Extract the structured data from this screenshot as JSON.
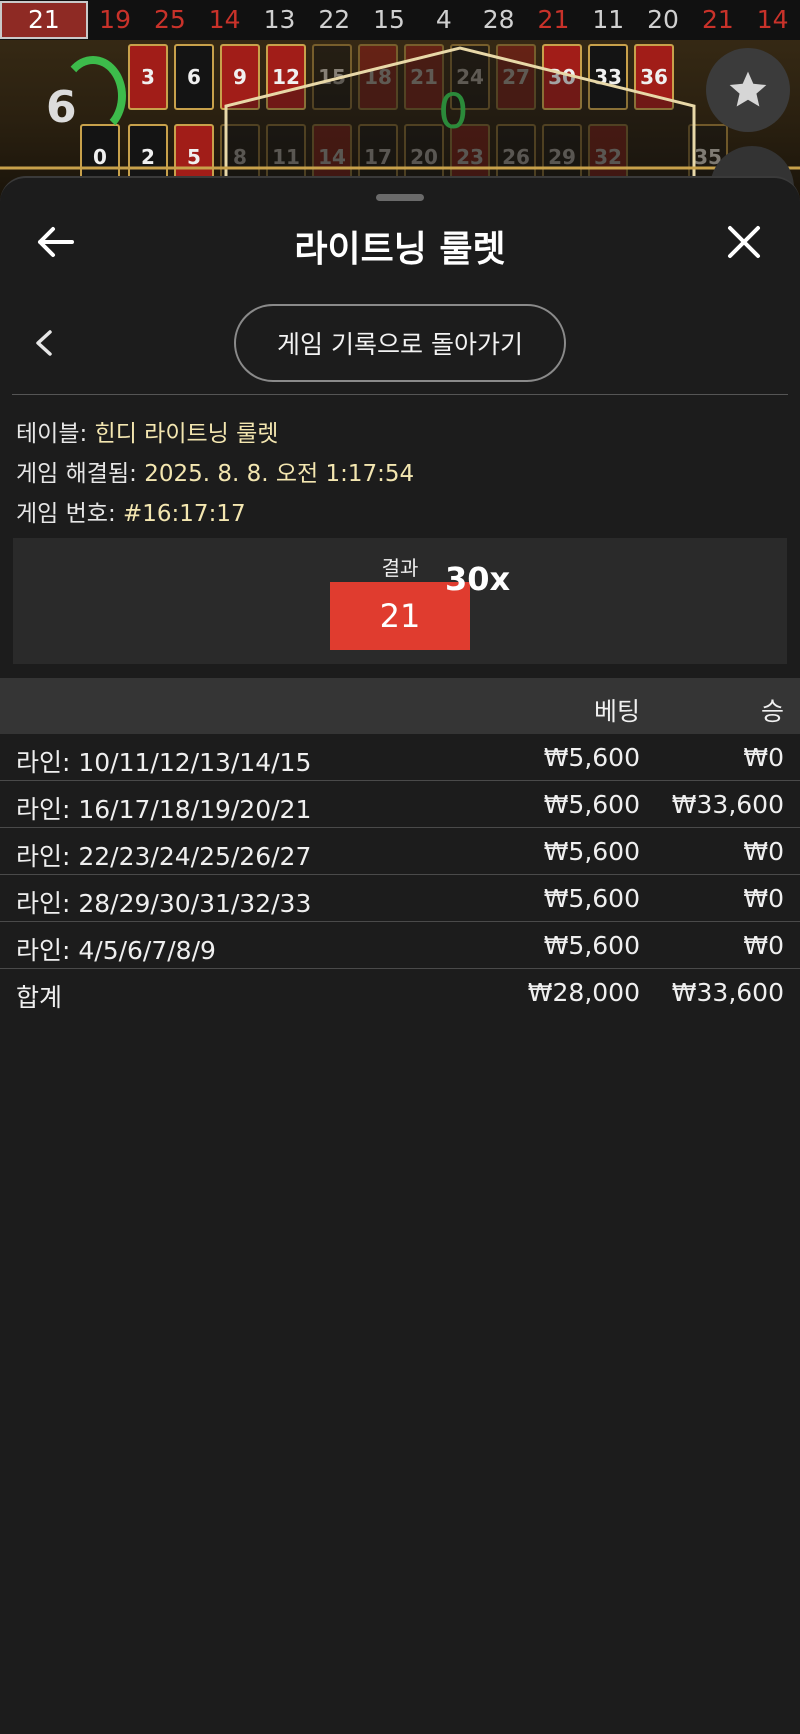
{
  "history": {
    "numbers": [
      {
        "n": "21",
        "color": "red",
        "current": true
      },
      {
        "n": "19",
        "color": "red"
      },
      {
        "n": "25",
        "color": "red"
      },
      {
        "n": "14",
        "color": "red"
      },
      {
        "n": "13",
        "color": "black"
      },
      {
        "n": "22",
        "color": "black"
      },
      {
        "n": "15",
        "color": "black"
      },
      {
        "n": "4",
        "color": "black"
      },
      {
        "n": "28",
        "color": "black"
      },
      {
        "n": "21",
        "color": "red"
      },
      {
        "n": "11",
        "color": "black"
      },
      {
        "n": "20",
        "color": "black"
      },
      {
        "n": "21",
        "color": "red"
      },
      {
        "n": "14",
        "color": "red"
      }
    ]
  },
  "game": {
    "timer": "6",
    "zero": "0",
    "board_top": [
      "3",
      "6",
      "9",
      "12",
      "15",
      "18",
      "21",
      "24",
      "27",
      "30",
      "33",
      "36"
    ],
    "board_mid": [
      "0",
      "2",
      "5",
      "8",
      "11",
      "14",
      "17",
      "20",
      "23",
      "26",
      "29",
      "32",
      "35"
    ]
  },
  "sheet": {
    "title": "라이트닝 룰렛",
    "history_button": "게임 기록으로 돌아가기",
    "info": {
      "table_label": "테이블:",
      "table_value": "힌디 라이트닝 룰렛",
      "resolved_label": "게임 해결됨:",
      "resolved_value": "2025. 8. 8. 오전 1:17:54",
      "number_label": "게임 번호:",
      "number_value": "#16:17:17"
    },
    "result": {
      "label": "결과",
      "number": "21",
      "multiplier": "30x"
    },
    "table": {
      "header_bet": "베팅",
      "header_win": "승",
      "rows": [
        {
          "label": "라인: 10/11/12/13/14/15",
          "bet": "₩5,600",
          "win": "₩0"
        },
        {
          "label": "라인: 16/17/18/19/20/21",
          "bet": "₩5,600",
          "win": "₩33,600"
        },
        {
          "label": "라인: 22/23/24/25/26/27",
          "bet": "₩5,600",
          "win": "₩0"
        },
        {
          "label": "라인: 28/29/30/31/32/33",
          "bet": "₩5,600",
          "win": "₩0"
        },
        {
          "label": "라인: 4/5/6/7/8/9",
          "bet": "₩5,600",
          "win": "₩0"
        }
      ],
      "total": {
        "label": "합계",
        "bet": "₩28,000",
        "win": "₩33,600"
      }
    }
  },
  "colors": {
    "result_red": "#e03c2f",
    "timer_green": "#3dbb4b"
  },
  "icons": {
    "back": "back-arrow-icon",
    "close": "close-icon",
    "chevron": "chevron-left-icon",
    "star": "star-icon"
  }
}
